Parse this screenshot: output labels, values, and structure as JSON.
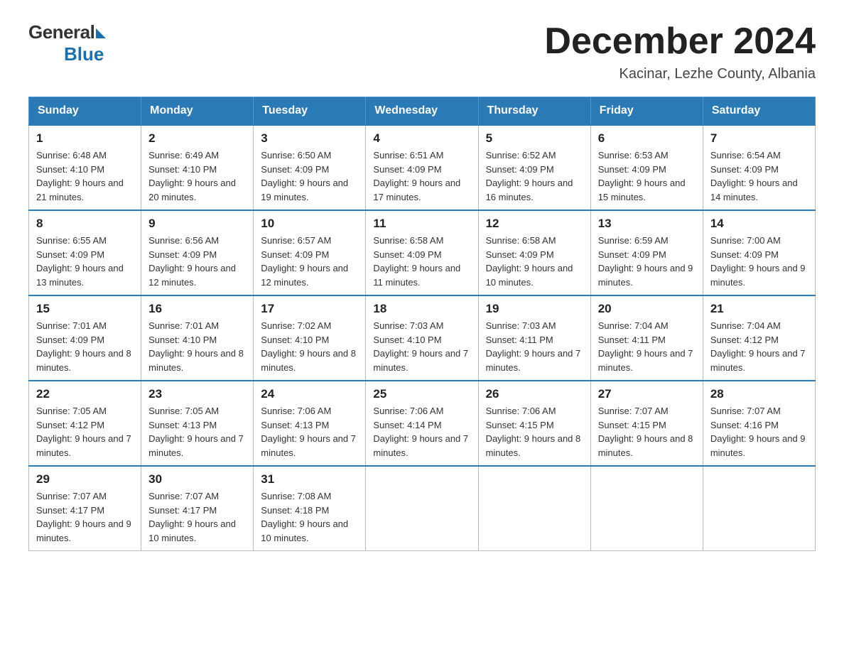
{
  "header": {
    "logo_general": "General",
    "logo_blue": "Blue",
    "month_title": "December 2024",
    "location": "Kacinar, Lezhe County, Albania"
  },
  "days_of_week": [
    "Sunday",
    "Monday",
    "Tuesday",
    "Wednesday",
    "Thursday",
    "Friday",
    "Saturday"
  ],
  "weeks": [
    [
      {
        "day": "1",
        "sunrise": "6:48 AM",
        "sunset": "4:10 PM",
        "daylight": "9 hours and 21 minutes."
      },
      {
        "day": "2",
        "sunrise": "6:49 AM",
        "sunset": "4:10 PM",
        "daylight": "9 hours and 20 minutes."
      },
      {
        "day": "3",
        "sunrise": "6:50 AM",
        "sunset": "4:09 PM",
        "daylight": "9 hours and 19 minutes."
      },
      {
        "day": "4",
        "sunrise": "6:51 AM",
        "sunset": "4:09 PM",
        "daylight": "9 hours and 17 minutes."
      },
      {
        "day": "5",
        "sunrise": "6:52 AM",
        "sunset": "4:09 PM",
        "daylight": "9 hours and 16 minutes."
      },
      {
        "day": "6",
        "sunrise": "6:53 AM",
        "sunset": "4:09 PM",
        "daylight": "9 hours and 15 minutes."
      },
      {
        "day": "7",
        "sunrise": "6:54 AM",
        "sunset": "4:09 PM",
        "daylight": "9 hours and 14 minutes."
      }
    ],
    [
      {
        "day": "8",
        "sunrise": "6:55 AM",
        "sunset": "4:09 PM",
        "daylight": "9 hours and 13 minutes."
      },
      {
        "day": "9",
        "sunrise": "6:56 AM",
        "sunset": "4:09 PM",
        "daylight": "9 hours and 12 minutes."
      },
      {
        "day": "10",
        "sunrise": "6:57 AM",
        "sunset": "4:09 PM",
        "daylight": "9 hours and 12 minutes."
      },
      {
        "day": "11",
        "sunrise": "6:58 AM",
        "sunset": "4:09 PM",
        "daylight": "9 hours and 11 minutes."
      },
      {
        "day": "12",
        "sunrise": "6:58 AM",
        "sunset": "4:09 PM",
        "daylight": "9 hours and 10 minutes."
      },
      {
        "day": "13",
        "sunrise": "6:59 AM",
        "sunset": "4:09 PM",
        "daylight": "9 hours and 9 minutes."
      },
      {
        "day": "14",
        "sunrise": "7:00 AM",
        "sunset": "4:09 PM",
        "daylight": "9 hours and 9 minutes."
      }
    ],
    [
      {
        "day": "15",
        "sunrise": "7:01 AM",
        "sunset": "4:09 PM",
        "daylight": "9 hours and 8 minutes."
      },
      {
        "day": "16",
        "sunrise": "7:01 AM",
        "sunset": "4:10 PM",
        "daylight": "9 hours and 8 minutes."
      },
      {
        "day": "17",
        "sunrise": "7:02 AM",
        "sunset": "4:10 PM",
        "daylight": "9 hours and 8 minutes."
      },
      {
        "day": "18",
        "sunrise": "7:03 AM",
        "sunset": "4:10 PM",
        "daylight": "9 hours and 7 minutes."
      },
      {
        "day": "19",
        "sunrise": "7:03 AM",
        "sunset": "4:11 PM",
        "daylight": "9 hours and 7 minutes."
      },
      {
        "day": "20",
        "sunrise": "7:04 AM",
        "sunset": "4:11 PM",
        "daylight": "9 hours and 7 minutes."
      },
      {
        "day": "21",
        "sunrise": "7:04 AM",
        "sunset": "4:12 PM",
        "daylight": "9 hours and 7 minutes."
      }
    ],
    [
      {
        "day": "22",
        "sunrise": "7:05 AM",
        "sunset": "4:12 PM",
        "daylight": "9 hours and 7 minutes."
      },
      {
        "day": "23",
        "sunrise": "7:05 AM",
        "sunset": "4:13 PM",
        "daylight": "9 hours and 7 minutes."
      },
      {
        "day": "24",
        "sunrise": "7:06 AM",
        "sunset": "4:13 PM",
        "daylight": "9 hours and 7 minutes."
      },
      {
        "day": "25",
        "sunrise": "7:06 AM",
        "sunset": "4:14 PM",
        "daylight": "9 hours and 7 minutes."
      },
      {
        "day": "26",
        "sunrise": "7:06 AM",
        "sunset": "4:15 PM",
        "daylight": "9 hours and 8 minutes."
      },
      {
        "day": "27",
        "sunrise": "7:07 AM",
        "sunset": "4:15 PM",
        "daylight": "9 hours and 8 minutes."
      },
      {
        "day": "28",
        "sunrise": "7:07 AM",
        "sunset": "4:16 PM",
        "daylight": "9 hours and 9 minutes."
      }
    ],
    [
      {
        "day": "29",
        "sunrise": "7:07 AM",
        "sunset": "4:17 PM",
        "daylight": "9 hours and 9 minutes."
      },
      {
        "day": "30",
        "sunrise": "7:07 AM",
        "sunset": "4:17 PM",
        "daylight": "9 hours and 10 minutes."
      },
      {
        "day": "31",
        "sunrise": "7:08 AM",
        "sunset": "4:18 PM",
        "daylight": "9 hours and 10 minutes."
      },
      null,
      null,
      null,
      null
    ]
  ]
}
